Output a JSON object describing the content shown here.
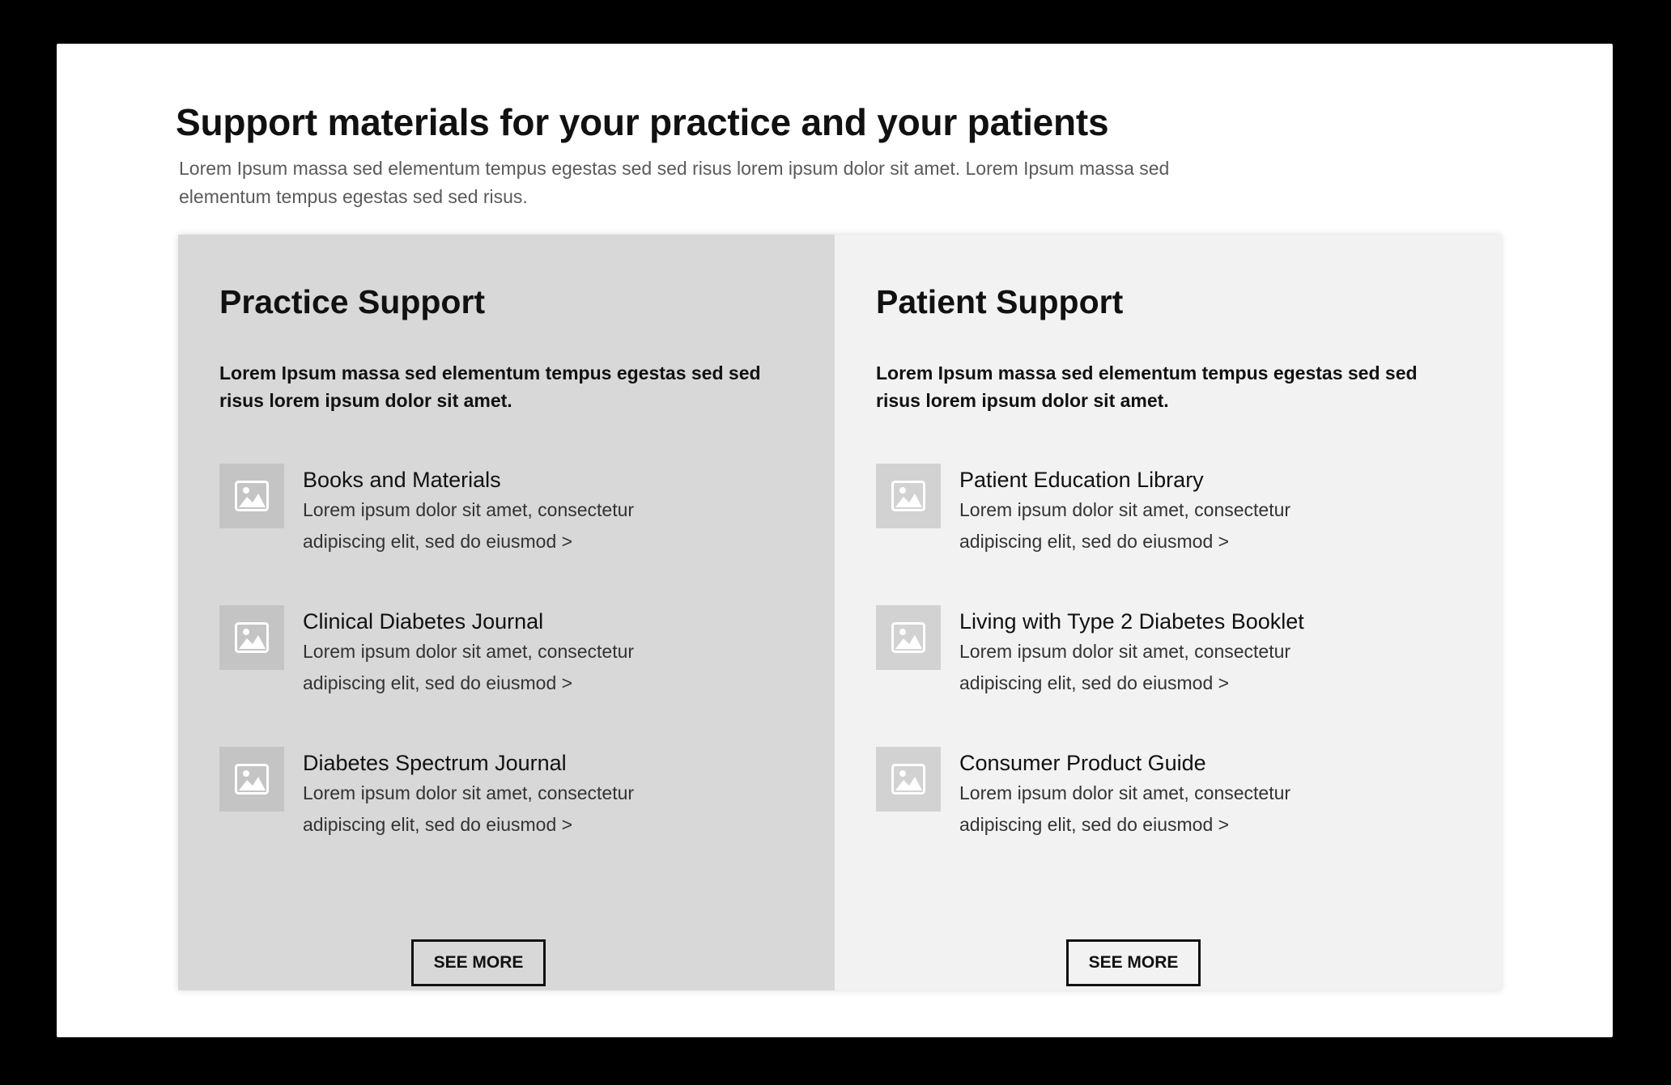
{
  "header": {
    "title": "Support materials for your practice and your patients",
    "intro": "Lorem Ipsum massa sed elementum tempus egestas sed sed risus lorem ipsum dolor sit amet. Lorem Ipsum massa sed elementum tempus egestas sed sed risus."
  },
  "practice": {
    "title": "Practice Support",
    "lead": "Lorem Ipsum massa sed elementum tempus egestas sed sed risus lorem ipsum dolor sit amet.",
    "items": [
      {
        "icon": "image-placeholder-icon",
        "title": "Books and Materials",
        "desc": "Lorem ipsum dolor sit amet, consectetur adipiscing elit, sed do eiusmod >"
      },
      {
        "icon": "image-placeholder-icon",
        "title": "Clinical Diabetes Journal",
        "desc": "Lorem ipsum dolor sit amet, consectetur adipiscing elit, sed do eiusmod >"
      },
      {
        "icon": "image-placeholder-icon",
        "title": "Diabetes Spectrum Journal",
        "desc": "Lorem ipsum dolor sit amet, consectetur adipiscing elit, sed do eiusmod >"
      }
    ],
    "button_label": "SEE MORE",
    "background": "#d8d8d8"
  },
  "patient": {
    "title": "Patient Support",
    "lead": "Lorem Ipsum massa sed elementum tempus egestas sed sed risus lorem ipsum dolor sit amet.",
    "items": [
      {
        "icon": "image-placeholder-icon",
        "title": "Patient Education Library",
        "desc": "Lorem ipsum dolor sit amet, consectetur adipiscing elit, sed do eiusmod >"
      },
      {
        "icon": "image-placeholder-icon",
        "title": "Living with Type 2 Diabetes Booklet",
        "desc": "Lorem ipsum dolor sit amet, consectetur adipiscing elit, sed do eiusmod >"
      },
      {
        "icon": "image-placeholder-icon",
        "title": "Consumer Product Guide",
        "desc": "Lorem ipsum dolor sit amet, consectetur adipiscing elit, sed do eiusmod >"
      }
    ],
    "button_label": "SEE MORE",
    "background": "#f2f2f2"
  }
}
